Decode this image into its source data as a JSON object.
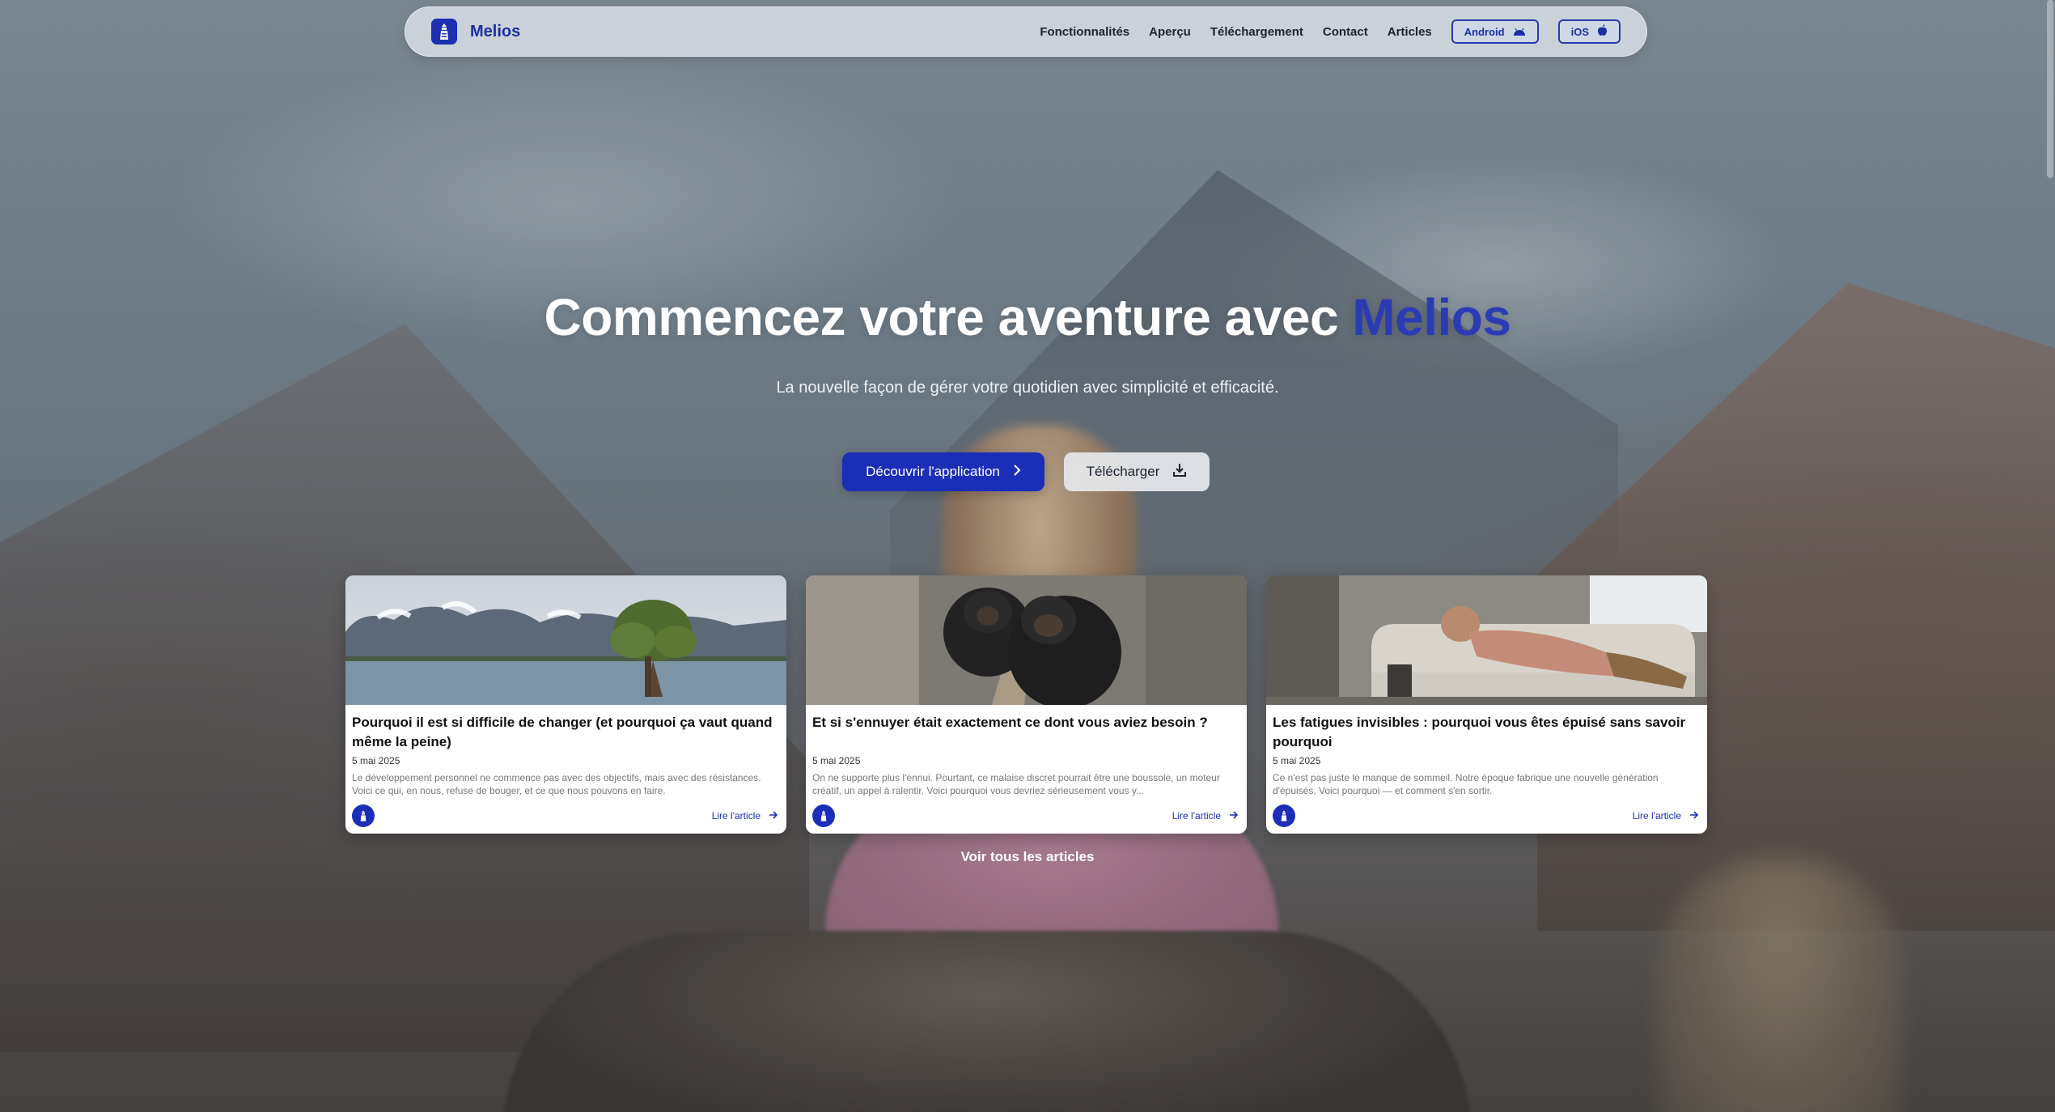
{
  "brand": {
    "name": "Melios",
    "logo_icon": "lighthouse-icon",
    "color": "#1b2eb8"
  },
  "nav": {
    "links": [
      "Fonctionnalités",
      "Aperçu",
      "Téléchargement",
      "Contact",
      "Articles"
    ],
    "android_label": "Android",
    "ios_label": "iOS"
  },
  "hero": {
    "title_prefix": "Commencez votre aventure avec",
    "title_brand": "Melios",
    "subtitle": "La nouvelle façon de gérer votre quotidien avec simplicité et efficacité.",
    "primary_cta": "Découvrir l'application",
    "secondary_cta": "Télécharger"
  },
  "articles": [
    {
      "title": "Pourquoi il est si difficile de changer (et pourquoi ça vaut quand même la peine)",
      "date": "5 mai 2025",
      "excerpt": "Le développement personnel ne commence pas avec des objectifs, mais avec des résistances. Voici ce qui, en nous, refuse de bouger, et ce que nous pouvons en faire.",
      "read_more": "Lire l'article",
      "image": "lake-tree-mountains"
    },
    {
      "title": "Et si s'ennuyer était exactement ce dont vous aviez besoin ?",
      "date": "5 mai 2025",
      "excerpt": "On ne supporte plus l'ennui. Pourtant, ce malaise discret pourrait être une boussole, un moteur créatif, un appel à ralentir. Voici pourquoi vous devriez sérieusement vous y...",
      "read_more": "Lire l'article",
      "image": "chimpanzees"
    },
    {
      "title": "Les fatigues invisibles : pourquoi vous êtes épuisé sans savoir pourquoi",
      "date": "5 mai 2025",
      "excerpt": "Ce n'est pas juste le manque de sommeil. Notre époque fabrique une nouvelle génération d'épuisés. Voici pourquoi — et comment s'en sortir.",
      "read_more": "Lire l'article",
      "image": "man-sleeping-sofa"
    }
  ],
  "see_all_label": "Voir tous les articles"
}
